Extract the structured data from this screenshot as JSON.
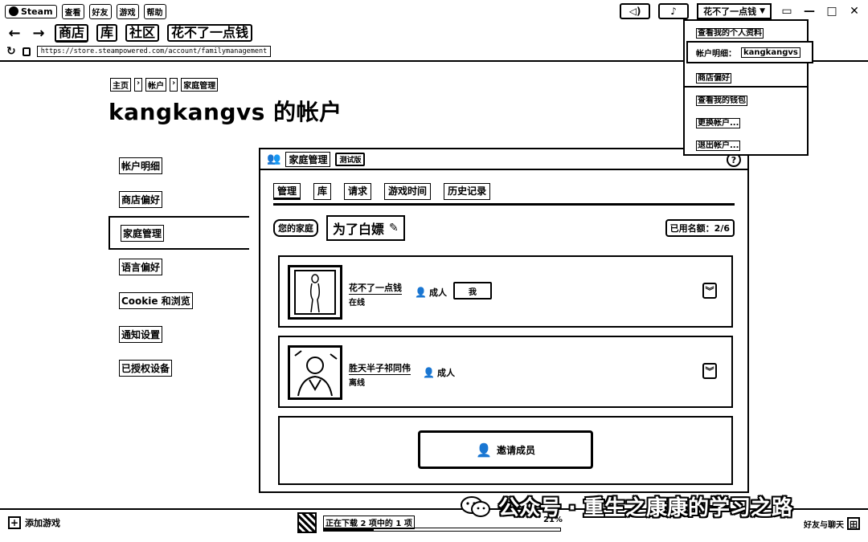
{
  "titlebar": {
    "app_name": "Steam",
    "menu": [
      "查看",
      "好友",
      "游戏",
      "帮助"
    ],
    "user_name": "花不了一点钱",
    "icons": [
      "broadcast-icon",
      "bell-icon",
      "minimize-icon",
      "maximize-icon",
      "close-icon"
    ]
  },
  "nav": {
    "tabs": [
      "商店",
      "库",
      "社区",
      "花不了一点钱"
    ],
    "active_tab": "商店"
  },
  "url": {
    "text": "https://store.steampowered.com/account/familymanagement"
  },
  "page": {
    "breadcrumb": [
      "主页",
      "帐户",
      "家庭管理"
    ],
    "title": "kangkangvs 的帐户"
  },
  "sidebar": {
    "items": [
      "帐户明细",
      "商店偏好",
      "家庭管理",
      "语言偏好",
      "Cookie 和浏览",
      "通知设置",
      "已授权设备"
    ],
    "active": "家庭管理"
  },
  "family": {
    "panel_title": "家庭管理",
    "badge": "测试版",
    "help": "?",
    "tabs": [
      "管理",
      "库",
      "请求",
      "游戏时间",
      "历史记录"
    ],
    "active_tab": "管理",
    "family_label": "您的家庭",
    "family_name": "为了白嫖",
    "slots": "已用名额：2/6",
    "members": [
      {
        "name": "花不了一点钱",
        "status": "在线",
        "role": "成人",
        "badge": "我"
      },
      {
        "name": "胜天半子祁同伟",
        "status": "离线",
        "role": "成人",
        "badge": ""
      }
    ],
    "invite_label": "邀请成员"
  },
  "dropdown": {
    "items": [
      "查看我的个人资料",
      "帐户明细：",
      "商店偏好",
      "查看我的钱包",
      "更换帐户...",
      "退出帐户..."
    ],
    "account": "kangkangvs"
  },
  "statusbar": {
    "add_game": "添加游戏",
    "download_status": "正在下载 2 项中的 1 项",
    "download_percent_text": "21%",
    "download_progress": 0.21,
    "friends": "好友与聊天"
  },
  "watermark": {
    "text": "公众号 · 重生之康康的学习之路"
  }
}
